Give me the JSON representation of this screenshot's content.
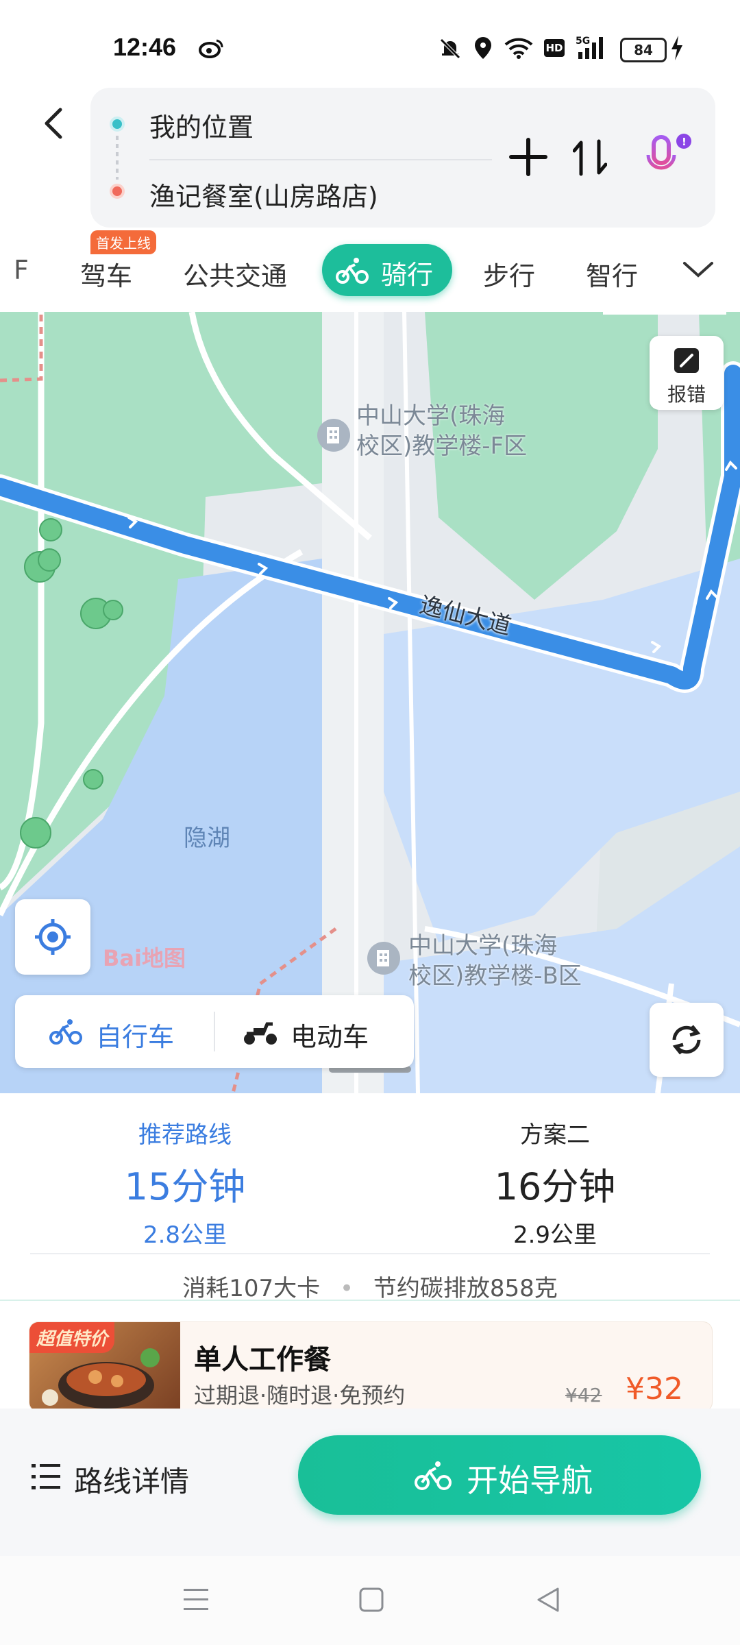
{
  "status_bar": {
    "time": "12:46",
    "battery": "84",
    "icons": [
      "weibo-icon",
      "mute-icon",
      "location-icon",
      "wifi-icon",
      "hd-icon",
      "5g-signal-icon",
      "battery-icon",
      "charging-icon"
    ]
  },
  "route": {
    "origin": "我的位置",
    "destination": "渔记餐室(山房路店)"
  },
  "tabs": {
    "partial_left": "F",
    "badge": "首发上线",
    "items": [
      "驾车",
      "公共交通",
      "骑行",
      "步行",
      "智行"
    ],
    "active": "骑行"
  },
  "map": {
    "report_label": "报错",
    "road_label": "逸仙大道",
    "poi_top": {
      "line1": "中山大学(珠海",
      "line2": "校区)教学楼-F区"
    },
    "poi_bottom": {
      "line1": "中山大学(珠海",
      "line2": "校区)教学楼-B区"
    },
    "lake_label": "隐湖",
    "logo": "Bai地图",
    "route_color": "#3a8ee6",
    "water_color": "#b7d3f7",
    "green_color": "#a9e0c4"
  },
  "vehicle_toggle": {
    "bicycle": "自行车",
    "ebike": "电动车"
  },
  "routes": [
    {
      "tag": "推荐路线",
      "time": "15分钟",
      "distance": "2.8公里",
      "selected": true
    },
    {
      "tag": "方案二",
      "time": "16分钟",
      "distance": "2.9公里",
      "selected": false
    }
  ],
  "stats": {
    "calories": "消耗107大卡",
    "carbon": "节约碳排放858克"
  },
  "promo": {
    "ribbon": "超值特价",
    "title": "单人工作餐",
    "subtitle": "过期退·随时退·免预约",
    "old_price": "¥42",
    "price": "¥32"
  },
  "bottom": {
    "details": "路线详情",
    "start": "开始导航"
  },
  "colors": {
    "accent": "#1dbe9b",
    "blue": "#3b7de0",
    "orange": "#f05a28"
  }
}
